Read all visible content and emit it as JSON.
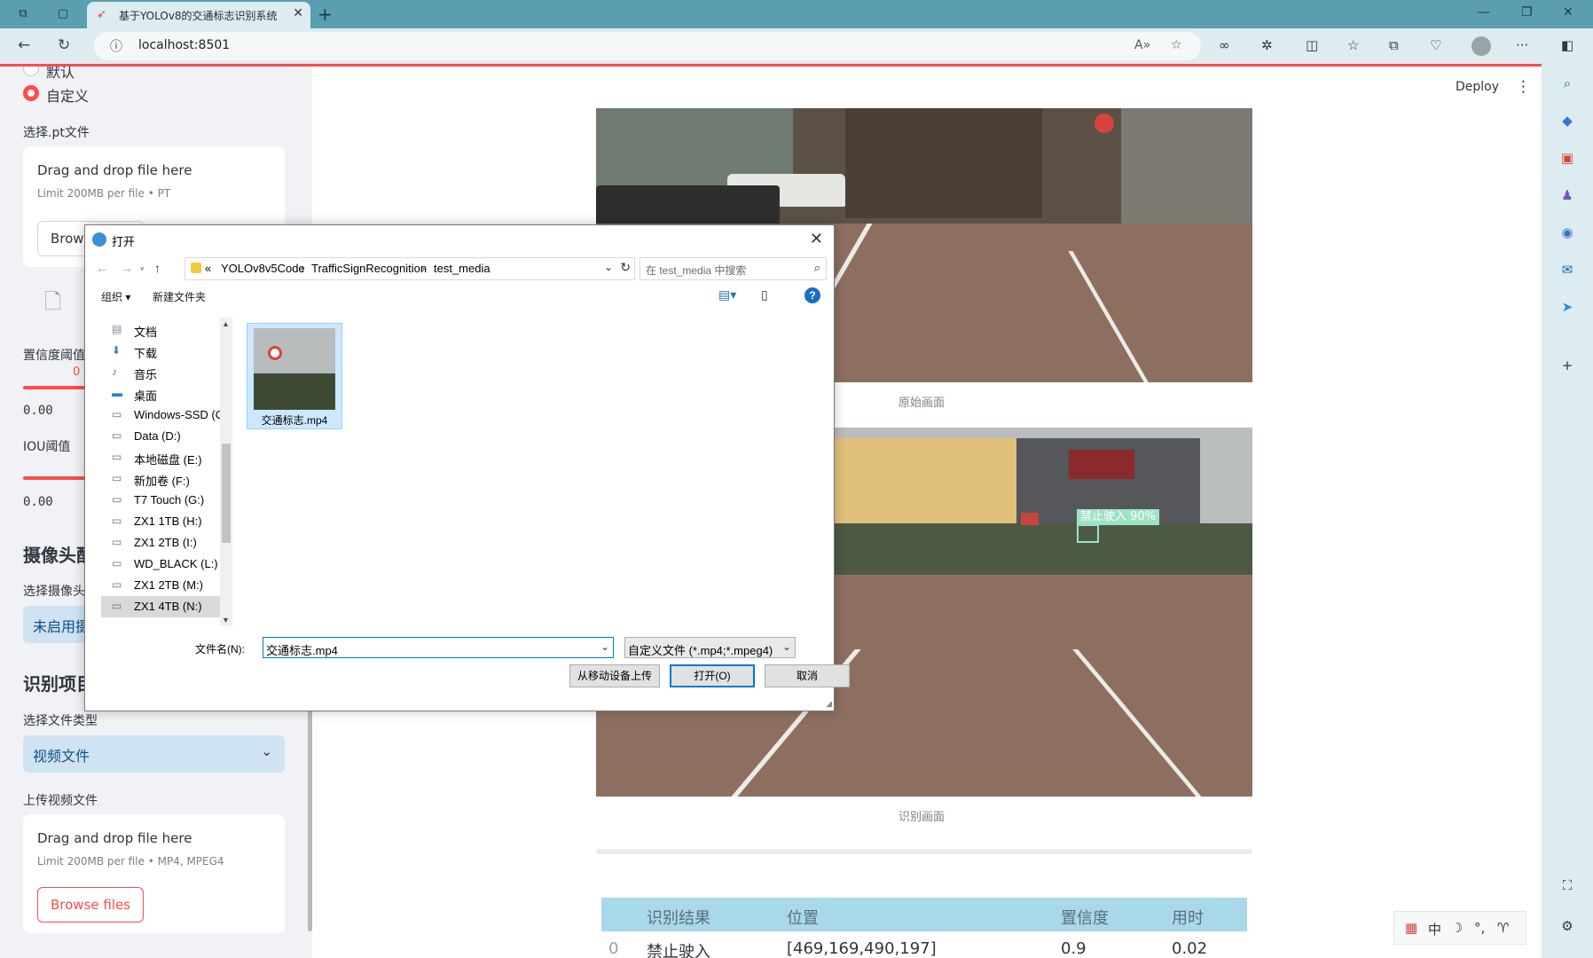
{
  "browser": {
    "tab_title": "基于YOLOv8的交通标志识别系统",
    "url": "localhost:8501"
  },
  "sidebar": {
    "radio_default": "默认",
    "radio_custom": "自定义",
    "pt_label": "选择.pt文件",
    "pt_drop": "Drag and drop file here",
    "pt_limit": "Limit 200MB per file • PT",
    "browse_label": "Browse files",
    "conf_label": "置信度阈值",
    "conf_value_tag": "0",
    "conf_min": "0.00",
    "iou_label": "IOU阈值",
    "iou_min": "0.00",
    "camera_heading": "摄像头配置",
    "camera_select_label": "选择摄像头",
    "camera_select_value": "未启用摄像头",
    "project_heading": "识别项目设置",
    "file_type_label": "选择文件类型",
    "file_type_value": "视频文件",
    "upload_label": "上传视频文件",
    "video_drop": "Drag and drop file here",
    "video_limit": "Limit 200MB per file • MP4, MPEG4",
    "video_browse": "Browse files"
  },
  "main": {
    "deploy": "Deploy",
    "caption_original": "原始画面",
    "caption_detect": "识别画面",
    "detection_label": "禁止驶入 90%",
    "table": {
      "headers": [
        "识别结果",
        "位置",
        "置信度",
        "用时"
      ],
      "rows": [
        {
          "index": "0",
          "result": "禁止驶入",
          "position": "[469,169,490,197]",
          "confidence": "0.9",
          "time": "0.02"
        }
      ]
    }
  },
  "dialog": {
    "title": "打开",
    "breadcrumb": [
      "«",
      "YOLOv8v5Code",
      "TrafficSignRecognition",
      "test_media"
    ],
    "search_placeholder": "在 test_media 中搜索",
    "organize": "组织 ▾",
    "new_folder": "新建文件夹",
    "tree": [
      {
        "label": "文档",
        "icon": "document-icon"
      },
      {
        "label": "下载",
        "icon": "download-icon"
      },
      {
        "label": "音乐",
        "icon": "music-icon"
      },
      {
        "label": "桌面",
        "icon": "desktop-icon"
      },
      {
        "label": "Windows-SSD (C",
        "icon": "drive-icon"
      },
      {
        "label": "Data (D:)",
        "icon": "drive-icon"
      },
      {
        "label": "本地磁盘 (E:)",
        "icon": "drive-icon"
      },
      {
        "label": "新加卷 (F:)",
        "icon": "drive-icon"
      },
      {
        "label": "T7 Touch (G:)",
        "icon": "drive-icon"
      },
      {
        "label": "ZX1 1TB (H:)",
        "icon": "drive-icon"
      },
      {
        "label": "ZX1 2TB (I:)",
        "icon": "drive-icon"
      },
      {
        "label": "WD_BLACK (L:)",
        "icon": "drive-icon"
      },
      {
        "label": "ZX1 2TB (M:)",
        "icon": "drive-icon"
      },
      {
        "label": "ZX1 4TB (N:)",
        "icon": "drive-icon"
      }
    ],
    "file_name_thumb": "交通标志.mp4",
    "filename_label": "文件名(N):",
    "filename_value": "交通标志.mp4",
    "filetype_value": "自定义文件 (*.mp4;*.mpeg4)",
    "btn_mobile": "从移动设备上传",
    "btn_open": "打开(O)",
    "btn_cancel": "取消"
  },
  "colors": {
    "accent": "#ff4b4b",
    "sidebar_bg": "#f0f2f6",
    "select_bg": "#cfe3f3",
    "table_header": "#a8d8ea"
  }
}
